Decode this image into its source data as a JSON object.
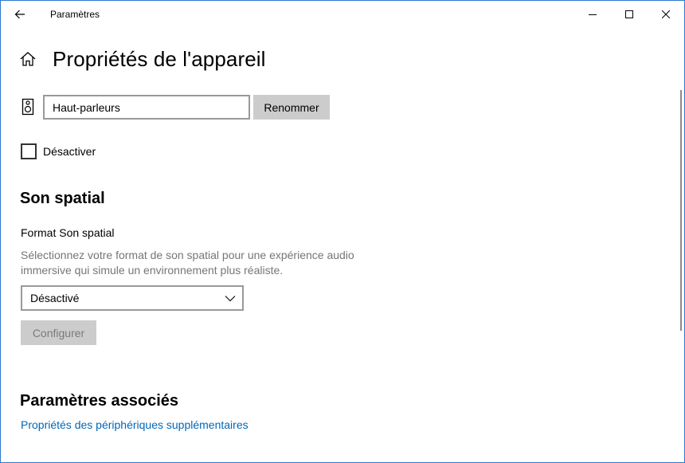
{
  "window": {
    "title": "Paramètres",
    "accent_color": "#2b79d0"
  },
  "header": {
    "title": "Propriétés de l'appareil"
  },
  "device": {
    "name_value": "Haut-parleurs",
    "rename_label": "Renommer",
    "disable_label": "Désactiver",
    "disable_checked": false
  },
  "spatial": {
    "section_title": "Son spatial",
    "format_label": "Format Son spatial",
    "description": "Sélectionnez votre format de son spatial pour une expérience audio immersive qui simule un environnement plus réaliste.",
    "selected_value": "Désactivé",
    "configure_label": "Configurer"
  },
  "related": {
    "section_title": "Paramètres associés",
    "link_label": "Propriétés des périphériques supplémentaires",
    "link_color": "#0067b8"
  },
  "icons": {
    "back": "back-arrow-icon",
    "home": "home-icon",
    "speaker": "speaker-icon",
    "minimize": "minimize-icon",
    "maximize": "maximize-icon",
    "close": "close-icon",
    "dropdown": "chevron-down-icon"
  }
}
